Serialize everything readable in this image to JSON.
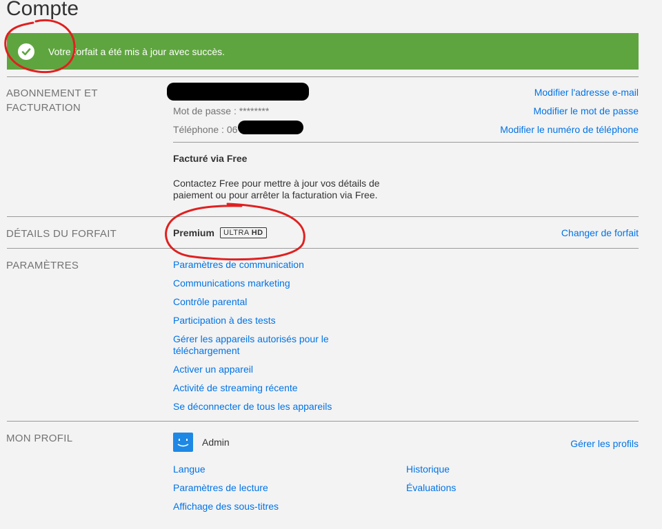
{
  "page": {
    "title": "Compte"
  },
  "banner": {
    "message": "Votre forfait a été mis à jour avec succès.",
    "color": "#5fa53f"
  },
  "membership": {
    "label_line1": "ABONNEMENT ET",
    "label_line2": "FACTURATION",
    "password_label": "Mot de passe : ********",
    "phone_label": "Téléphone : 06",
    "edit_email": "Modifier l'adresse e-mail",
    "edit_password": "Modifier le mot de passe",
    "edit_phone": "Modifier le numéro de téléphone",
    "billed_via": "Facturé via Free",
    "billing_note_line1": "Contactez Free pour mettre à jour vos détails de",
    "billing_note_line2": "paiement ou pour arrêter la facturation via Free."
  },
  "plan": {
    "label": "DÉTAILS DU FORFAIT",
    "name": "Premium",
    "badge_ultra": "ULTRA",
    "badge_hd": "HD",
    "change_plan": "Changer de forfait"
  },
  "settings": {
    "label": "PARAMÈTRES",
    "items": [
      "Paramètres de communication",
      "Communications marketing",
      "Contrôle parental",
      "Participation à des tests",
      "Gérer les appareils autorisés pour le",
      "téléchargement",
      "Activer un appareil",
      "Activité de streaming récente",
      "Se déconnecter de tous les appareils"
    ]
  },
  "profile": {
    "label": "MON PROFIL",
    "name": "Admin",
    "manage_profiles": "Gérer les profils",
    "links_left": [
      "Langue",
      "Paramètres de lecture",
      "Affichage des sous-titres"
    ],
    "links_right": [
      "Historique",
      "Évaluations"
    ]
  },
  "colors": {
    "link": "#0073e6",
    "accent_annotation": "#e02020"
  }
}
